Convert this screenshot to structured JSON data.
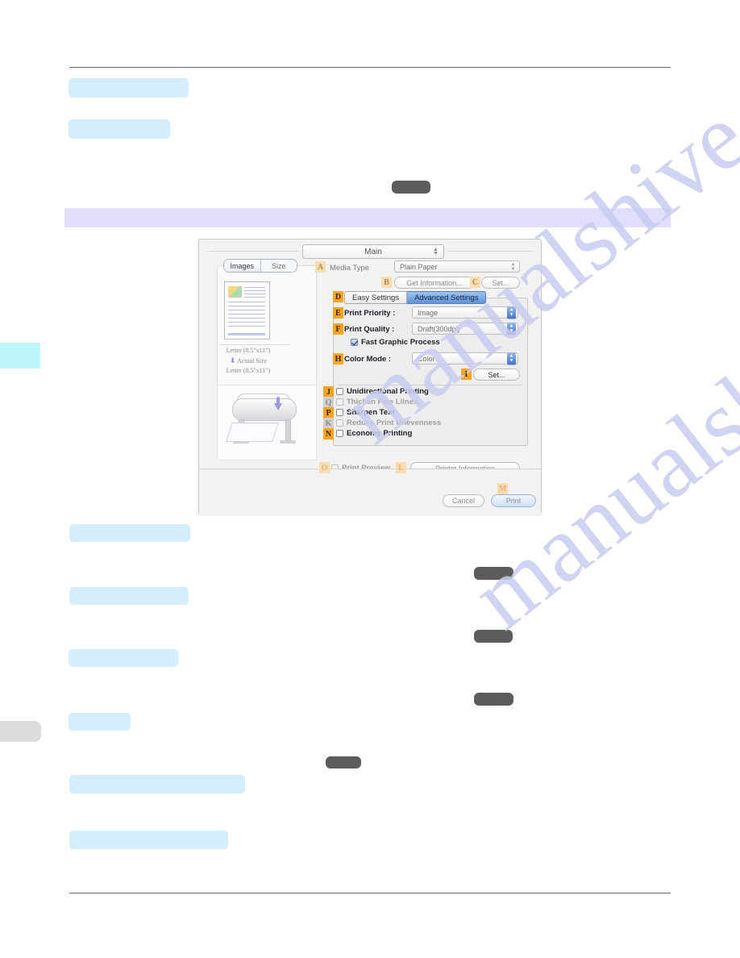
{
  "page": {
    "watermark": [
      "manualshive.com",
      "manualshive.com"
    ],
    "rules": [
      "top-rule",
      "bottom-rule"
    ]
  },
  "dialog": {
    "popup_main": "Main",
    "popup_main_icon": "stepper-arrows-icon",
    "preview": {
      "tab_images": "Images",
      "tab_size": "Size",
      "paper_size_top": "Letter (8.5\"x11\")",
      "scale_label": "Actual Size",
      "scale_icon": "arrow-down-icon",
      "paper_size_bottom": "Letter (8.5\"x11\")",
      "printer_illustration": "printer-illustration"
    },
    "media_type_label": "Media Type",
    "media_type_value": "Plain Paper",
    "get_information_button": "Get Information...",
    "set_button_top": "Set...",
    "tabs": {
      "easy": "Easy Settings",
      "advanced": "Advanced Settings",
      "active": "Advanced Settings"
    },
    "fields": [
      {
        "label": "Print Priority :",
        "value": "Image"
      },
      {
        "label": "Print Quality :",
        "value": "Draft(300dpi)"
      },
      {
        "label": "Color Mode :",
        "value": "Color"
      }
    ],
    "fast_graphic_process": "Fast Graphic Process",
    "set_button_color": "Set...",
    "checkboxes": [
      {
        "label": "Unidirectional Printing",
        "checked": false,
        "enabled": true
      },
      {
        "label": "Thicken Fine Lilnes",
        "checked": false,
        "enabled": false
      },
      {
        "label": "Sharpen Text",
        "checked": false,
        "enabled": true
      },
      {
        "label": "Reduce Print Unevenness",
        "checked": false,
        "enabled": false
      },
      {
        "label": "Economy Printing",
        "checked": false,
        "enabled": true
      }
    ],
    "print_preview": "Print Preview",
    "printer_information_button": "Printer Information",
    "cancel_button": "Cancel",
    "print_button": "Print",
    "callouts": [
      {
        "letter": "A",
        "style": "pale"
      },
      {
        "letter": "B",
        "style": "pale"
      },
      {
        "letter": "C",
        "style": "pale"
      },
      {
        "letter": "D",
        "style": "solid"
      },
      {
        "letter": "E",
        "style": "solid"
      },
      {
        "letter": "F",
        "style": "solid"
      },
      {
        "letter": "H",
        "style": "solid"
      },
      {
        "letter": "I",
        "style": "solid"
      },
      {
        "letter": "J",
        "style": "solid"
      },
      {
        "letter": "Q",
        "style": "dimmed"
      },
      {
        "letter": "P",
        "style": "solid"
      },
      {
        "letter": "K",
        "style": "dimmed"
      },
      {
        "letter": "N",
        "style": "solid"
      },
      {
        "letter": "O",
        "style": "ghost"
      },
      {
        "letter": "L",
        "style": "ghost"
      },
      {
        "letter": "M",
        "style": "ghost"
      }
    ]
  },
  "colors": {
    "redaction_blue": "#d4eefc",
    "redaction_gray": "#5c5c5c",
    "section_band": "#e0defa",
    "edge_tab_cyan": "#bdf7fa",
    "edge_tab_gray": "#dcdcdc",
    "callout_orange": "#f7a520",
    "tab_active_blue": "#5f93d8"
  }
}
